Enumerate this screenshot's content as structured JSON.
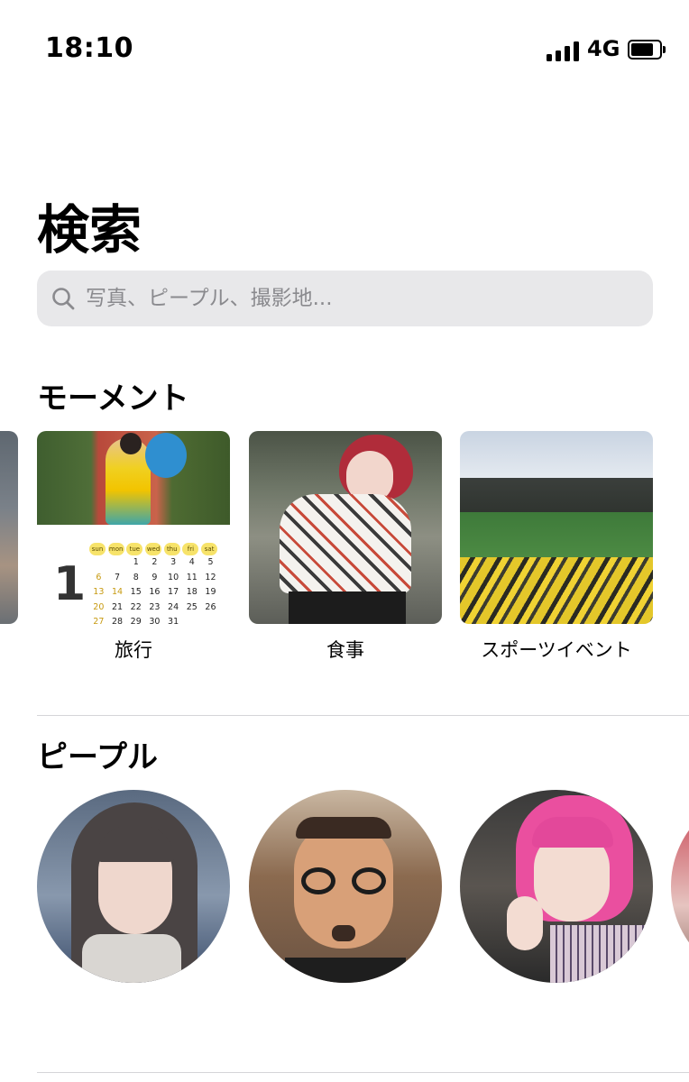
{
  "status_bar": {
    "time": "18:10",
    "network": "4G",
    "signal_bars": 4,
    "battery_level": 0.75
  },
  "page": {
    "title": "検索"
  },
  "search": {
    "placeholder": "写真、ピープル、撮影地..."
  },
  "moments": {
    "title": "モーメント",
    "items": [
      {
        "label": "旅行",
        "calendar": {
          "month_number": "1",
          "weekdays": [
            "sun",
            "mon",
            "tue",
            "wed",
            "thu",
            "fri",
            "sat"
          ],
          "rows": [
            [
              "",
              "",
              "1",
              "2",
              "3",
              "4",
              "5"
            ],
            [
              "6",
              "7",
              "8",
              "9",
              "10",
              "11",
              "12"
            ],
            [
              "13",
              "14",
              "15",
              "16",
              "17",
              "18",
              "19"
            ],
            [
              "20",
              "21",
              "22",
              "23",
              "24",
              "25",
              "26"
            ],
            [
              "27",
              "28",
              "29",
              "30",
              "31",
              "",
              ""
            ]
          ]
        }
      },
      {
        "label": "食事"
      },
      {
        "label": "スポーツイベント"
      }
    ]
  },
  "people": {
    "title": "ピープル"
  },
  "colors": {
    "search_bg": "#e8e8ea",
    "divider": "#d5d5d8",
    "placeholder": "#8a8a8e",
    "calendar_highlight": "#f7e36a"
  }
}
